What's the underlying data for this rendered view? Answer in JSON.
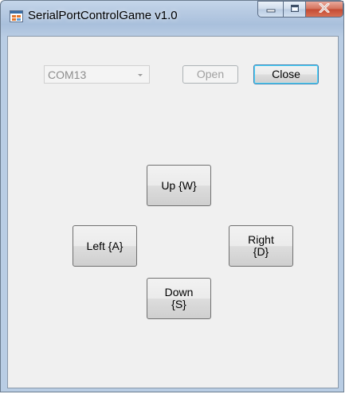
{
  "window": {
    "title": "SerialPortControlGame v1.0",
    "controls": {
      "minimize_icon": "minimize-icon",
      "maximize_icon": "maximize-icon",
      "close_icon": "close-window-icon"
    }
  },
  "port": {
    "selected": "COM13",
    "enabled": false
  },
  "buttons": {
    "open": {
      "label": "Open",
      "enabled": false
    },
    "close": {
      "label": "Close",
      "enabled": true
    },
    "up": "Up {W}",
    "left": "Left {A}",
    "right": "Right\n{D}",
    "down": "Down\n{S}"
  },
  "colors": {
    "client_background": "#f0f0f0",
    "focus_border": "#3c7fb1",
    "close_control": "#c34a33"
  }
}
